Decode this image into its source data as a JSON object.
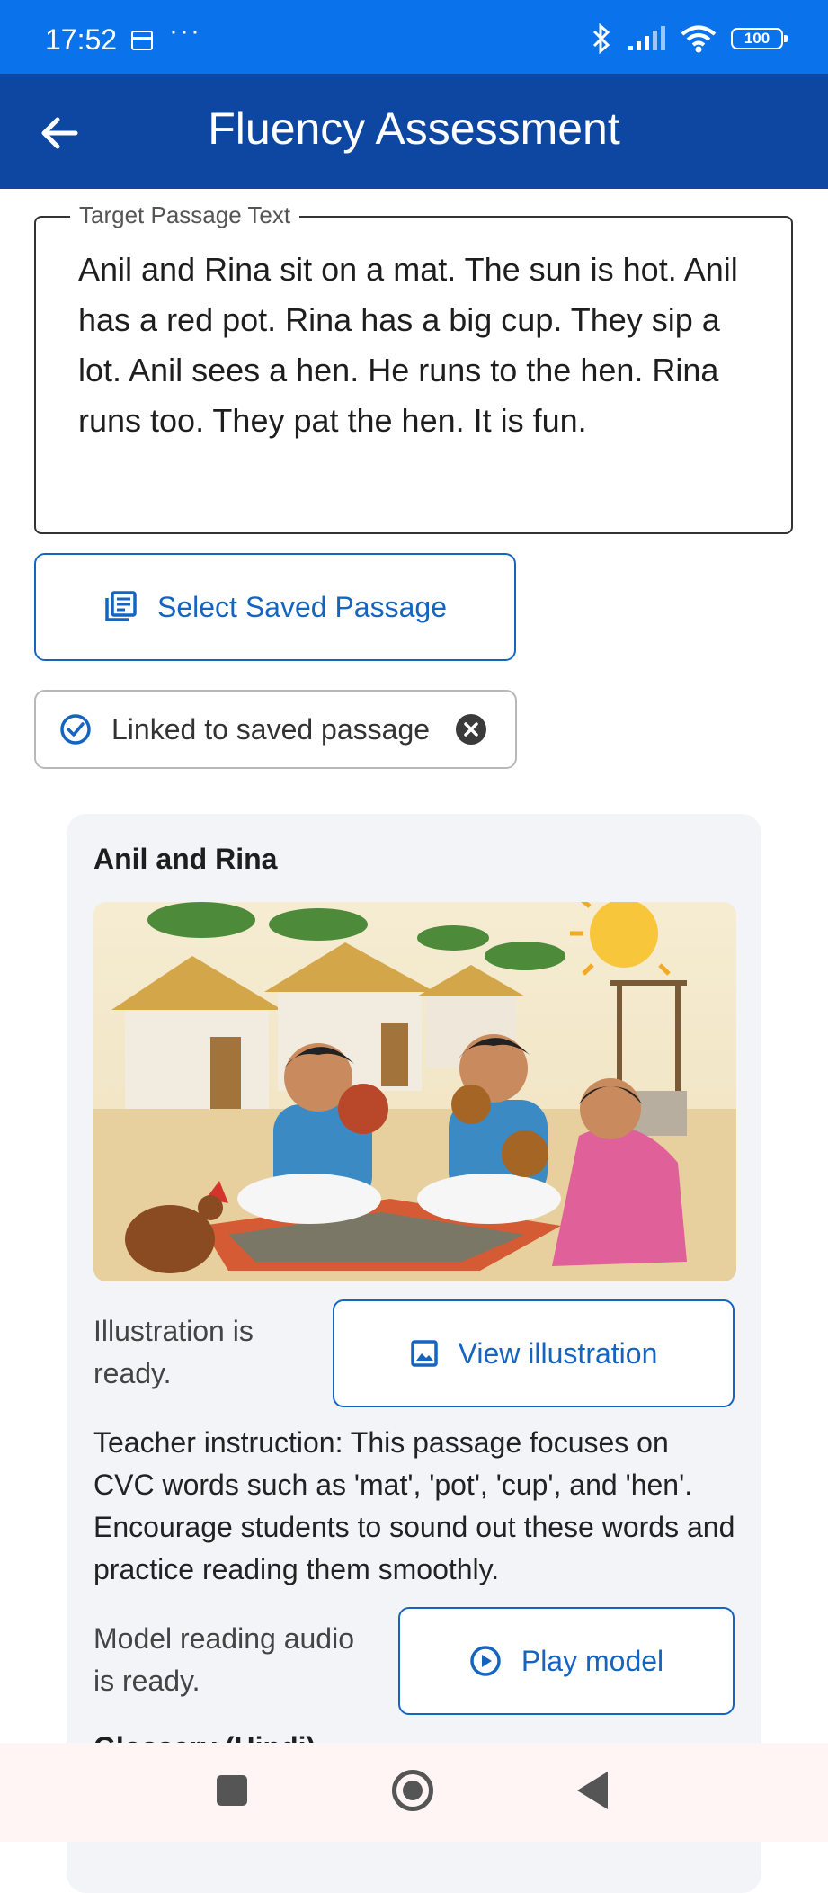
{
  "status_bar": {
    "time": "17:52",
    "more": "···",
    "battery": "100",
    "color": "#0a73eb"
  },
  "app_bar": {
    "title": "Fluency Assessment",
    "color": "#0d47a1"
  },
  "passage_field": {
    "label": "Target Passage Text",
    "text": "Anil and Rina sit on a mat. The sun is hot. Anil has a red pot. Rina has a big cup. They sip a lot. Anil sees a hen. He runs to the hen. Rina runs too. They pat the hen. It is fun."
  },
  "select_saved_passage": {
    "label": "Select Saved Passage",
    "icon": "library-books-icon"
  },
  "linked_chip": {
    "label": "Linked to saved passage",
    "icon": "check-circle-icon",
    "close_icon": "cancel-icon"
  },
  "card": {
    "title": "Anil and Rina",
    "illustration_status": "Illustration is ready.",
    "view_illustration_label": "View illustration",
    "teacher_instruction": "Teacher instruction: This passage focuses on CVC words such as 'mat', 'pot', 'cup', and 'hen'. Encourage students to sound out these words and practice reading them smoothly.",
    "audio_status": "Model reading audio is ready.",
    "play_model_label": "Play model",
    "next_heading_partial": "Glossary (Hindi)"
  },
  "accent_color": "#1565c0"
}
